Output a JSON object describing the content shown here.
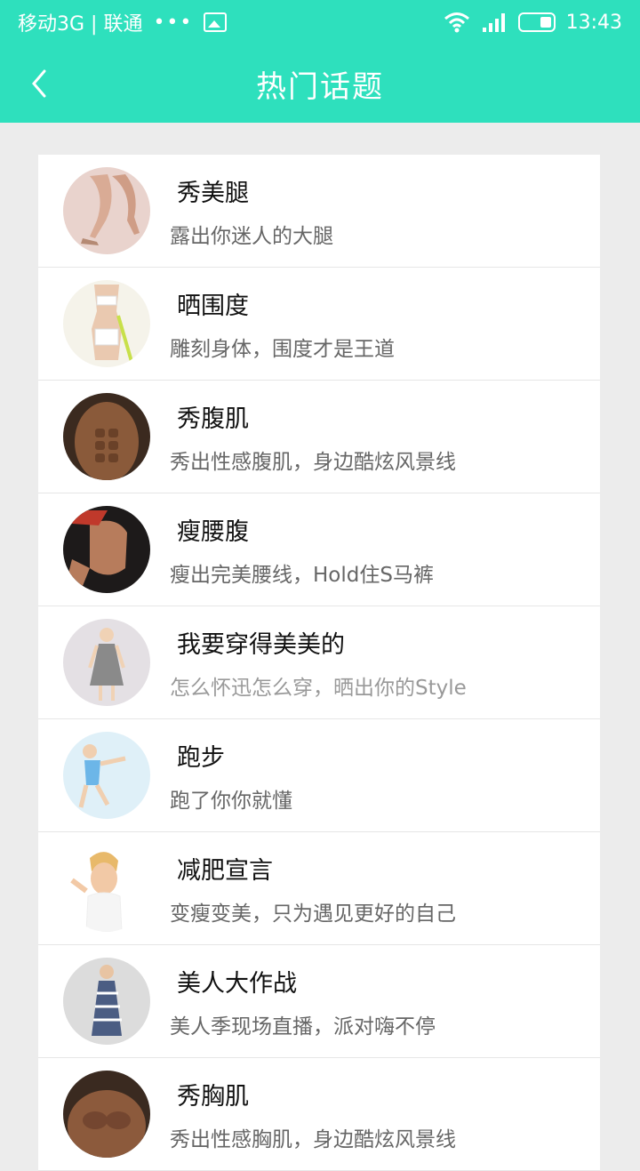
{
  "status": {
    "carrier": "移动3G | 联通",
    "dots": "•••",
    "time": "13:43"
  },
  "header": {
    "title": "热门话题"
  },
  "topics": [
    {
      "name": "秀美腿",
      "desc": "露出你迷人的大腿"
    },
    {
      "name": "晒围度",
      "desc": "雕刻身体，围度才是王道"
    },
    {
      "name": "秀腹肌",
      "desc": "秀出性感腹肌，身边酷炫风景线"
    },
    {
      "name": "瘦腰腹",
      "desc": "瘦出完美腰线，Hold住S马裤"
    },
    {
      "name": "我要穿得美美的",
      "desc": "怎么怀迅怎么穿，晒出你的Style"
    },
    {
      "name": "跑步",
      "desc": "跑了你你就懂"
    },
    {
      "name": "减肥宣言",
      "desc": "变瘦变美，只为遇见更好的自己"
    },
    {
      "name": "美人大作战",
      "desc": "美人季现场直播，派对嗨不停"
    },
    {
      "name": "秀胸肌",
      "desc": "秀出性感胸肌，身边酷炫风景线"
    }
  ],
  "colors": {
    "accent": "#2ee0bd"
  }
}
